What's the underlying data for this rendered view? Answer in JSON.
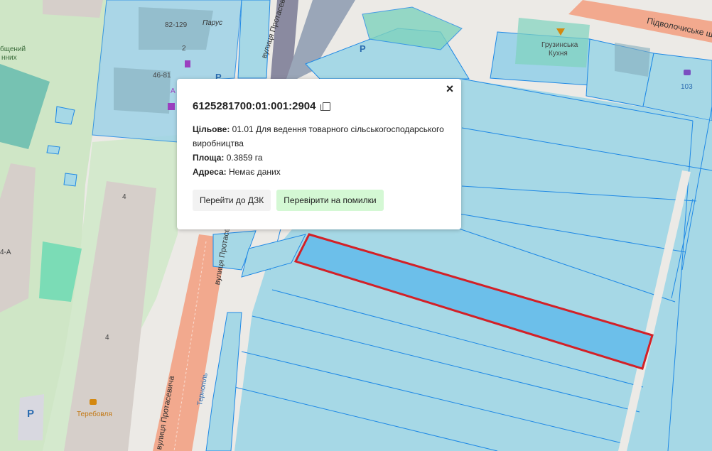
{
  "map": {
    "labels": {
      "street_protasevycha_1": "вулиця Протасевича",
      "street_protasevycha_2": "вулиця Протасевича",
      "street_protasevycha_3": "вулиця Протасевича",
      "street_pidvolochyske": "Підволочиське ш",
      "ternopil": "Тернопіль",
      "parus": "Парус",
      "house_82_129": "82-129",
      "house_2": "2",
      "house_46_81": "46-81",
      "house_4a": "4-А",
      "house_4_top": "4",
      "house_4_mid": "4",
      "gruzynska_kukhnia_1": "Грузинська",
      "gruzynska_kukhnia_2": "Кухня",
      "num_103": "103",
      "terebovlia": "Теребовля",
      "partial_top_left_1": "бщений",
      "partial_top_left_2": "нних",
      "parking": "P",
      "partial_a": "А"
    },
    "colors": {
      "parcel_fill": "#a6d8e6",
      "parcel_stroke": "#1e88e5",
      "selected_fill": "#6cbfea",
      "selected_stroke": "#d32027",
      "road_orange": "#f2a98e",
      "green_area": "#cde6c4",
      "teal_area": "#7bd9b6"
    }
  },
  "popup": {
    "cadastral_number": "6125281700:01:001:2904",
    "purpose_label": "Цільове:",
    "purpose_value": "01.01 Для ведення товарного сільськогосподарського виробництва",
    "area_label": "Площа:",
    "area_value": "0.3859 га",
    "address_label": "Адреса:",
    "address_value": "Немає даних",
    "btn_dzk": "Перейти до ДЗК",
    "btn_check": "Перевірити на помилки",
    "close_icon": "×"
  }
}
